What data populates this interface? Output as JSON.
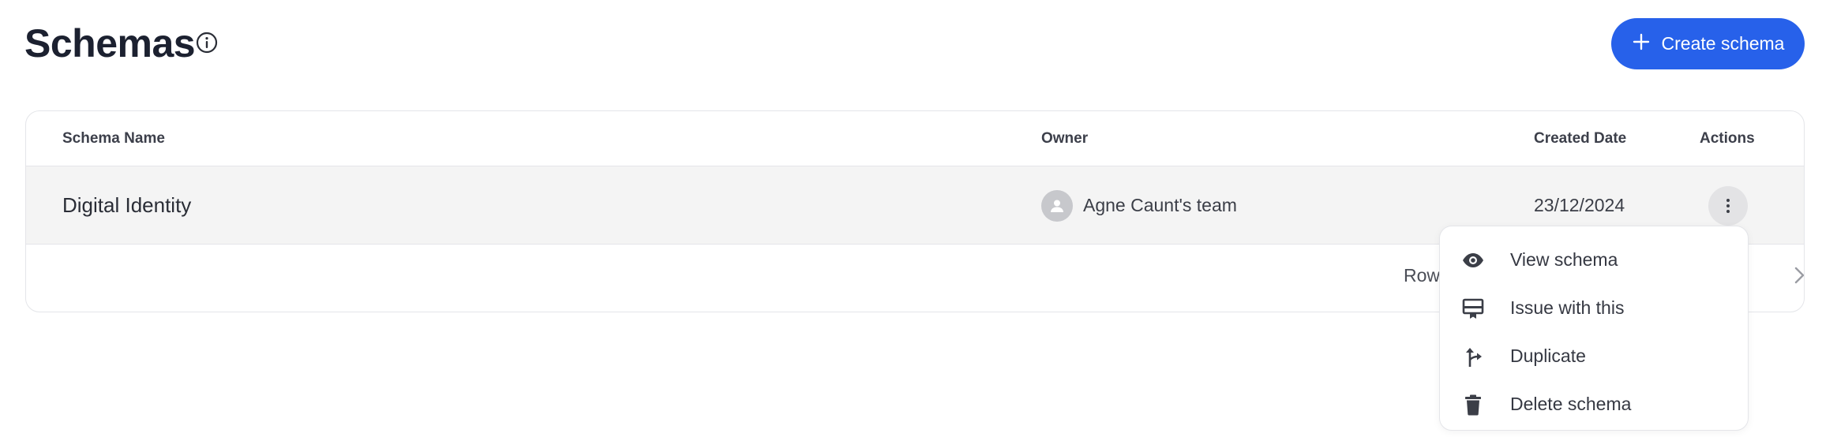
{
  "header": {
    "title": "Schemas",
    "info_icon": "info-circle-icon",
    "create_button_label": "Create schema",
    "create_button_icon": "plus-icon"
  },
  "colors": {
    "primary": "#2761ea",
    "row_highlight": "#f4f4f4",
    "border": "#e4e5e9",
    "avatar_bg": "#c7c8cc"
  },
  "table": {
    "columns": [
      "Schema Name",
      "Owner",
      "Created Date",
      "Actions"
    ],
    "rows": [
      {
        "name": "Digital Identity",
        "owner": "Agne Caunt's team",
        "created_date": "23/12/2024",
        "actions_icon": "more-vertical-icon"
      }
    ],
    "footer": {
      "rows_per_page_label": "Rows pe",
      "next_icon": "chevron-right-icon"
    }
  },
  "actions_menu": {
    "items": [
      {
        "label": "View schema",
        "icon": "eye-icon"
      },
      {
        "label": "Issue with this",
        "icon": "credential-icon"
      },
      {
        "label": "Duplicate",
        "icon": "fork-icon"
      },
      {
        "label": "Delete schema",
        "icon": "trash-icon"
      }
    ]
  }
}
